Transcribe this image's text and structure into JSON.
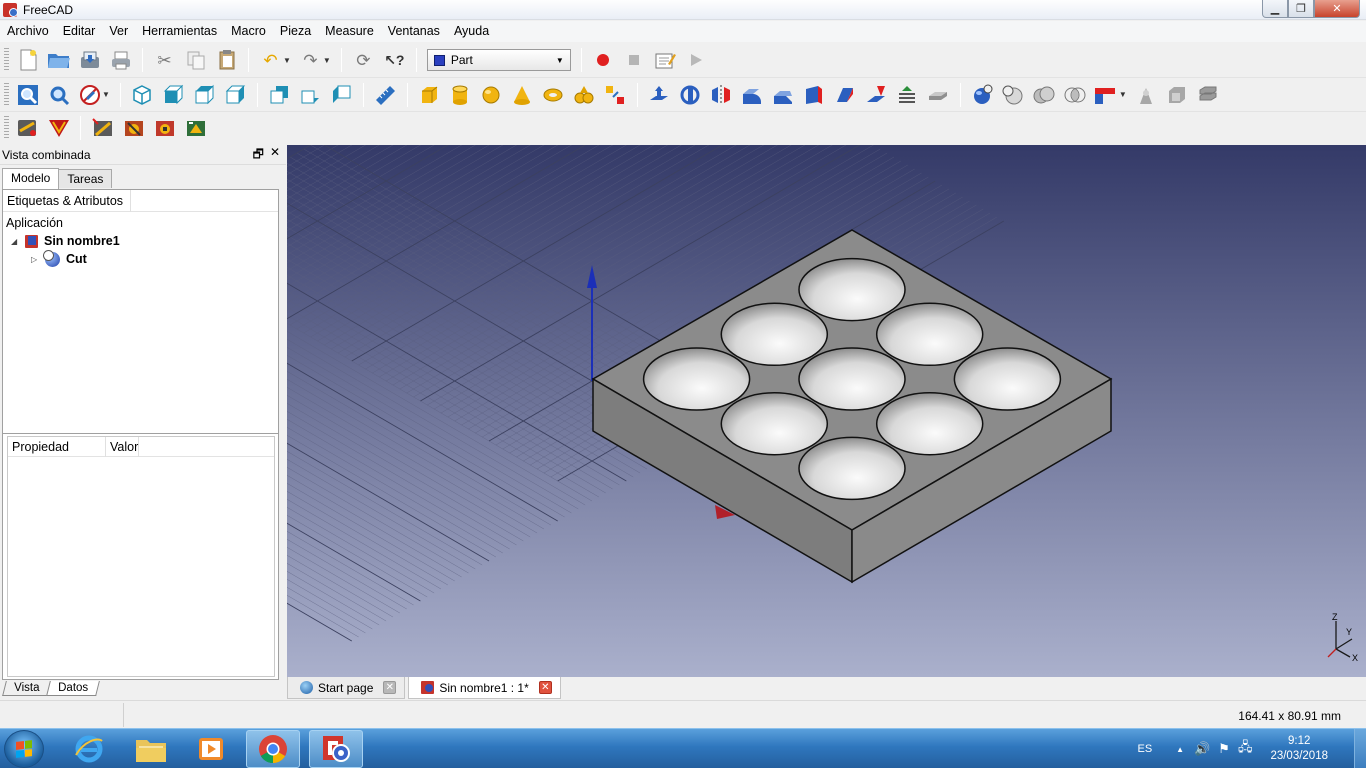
{
  "window": {
    "title": "FreeCAD"
  },
  "window_controls": {
    "minimize": "▁",
    "restore": "❐",
    "close": "✕"
  },
  "menu": [
    "Archivo",
    "Editar",
    "Ver",
    "Herramientas",
    "Macro",
    "Pieza",
    "Measure",
    "Ventanas",
    "Ayuda"
  ],
  "toolbar": {
    "workbench": "Part",
    "help_icon": "↖?"
  },
  "combo_view": {
    "title": "Vista combinada",
    "tabs": [
      "Modelo",
      "Tareas"
    ],
    "tree_header": "Etiquetas & Atributos",
    "tree_root": "Aplicación",
    "document": "Sin nombre1",
    "object": "Cut",
    "property_header": {
      "name": "Propiedad",
      "value": "Valor"
    },
    "bottom_tabs": [
      "Vista",
      "Datos"
    ]
  },
  "view": {
    "bg_top": "#343a68",
    "bg_bottom": "#aab0cc",
    "axis_labels": {
      "z": "Z",
      "y": "Y",
      "x": "X"
    }
  },
  "doc_tabs": [
    "Start page",
    "Sin nombre1 : 1*"
  ],
  "status": {
    "dimensions": "164.41 x 80.91 mm"
  },
  "taskbar": {
    "language": "ES",
    "time": "9:12",
    "date": "23/03/2018"
  }
}
